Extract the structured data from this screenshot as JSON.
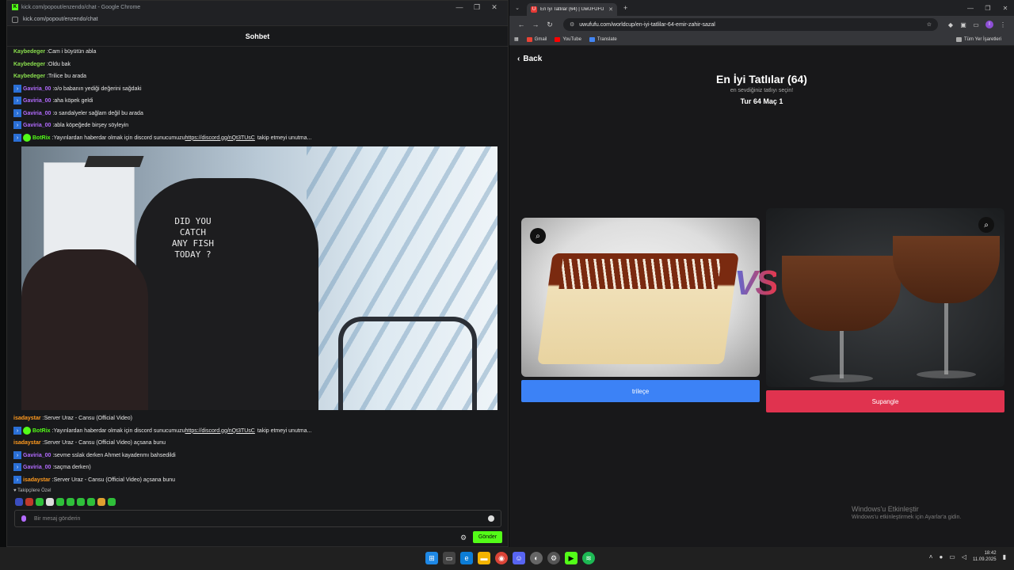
{
  "left_window": {
    "url_title": "kick.com/popout/enzendo/chat - Google Chrome",
    "url": "kick.com/popout/enzendo/chat",
    "window_controls": [
      "—",
      "❐",
      "✕"
    ],
    "chat_header": "Sohbet",
    "messages": [
      {
        "user": "Kaybedeger",
        "text": "Cam i büyütün abla",
        "color": "#8be04e",
        "badge": false
      },
      {
        "user": "Kaybedeger",
        "text": "Oldu bak",
        "color": "#8be04e",
        "badge": false
      },
      {
        "user": "Kaybedeger",
        "text": "Trilice bu arada",
        "color": "#8be04e",
        "badge": false
      },
      {
        "user": "Gaviria_00",
        "text": "o/o babanın yediği değerini sağdaki",
        "color": "#b36bff",
        "badge": true
      },
      {
        "user": "Gaviria_00",
        "text": "aha köpek geldi",
        "color": "#b36bff",
        "badge": true
      },
      {
        "user": "Gaviria_00",
        "text": "o sandalyeler sağlam değil bu arada",
        "color": "#b36bff",
        "badge": true
      },
      {
        "user": "Gaviria_00",
        "text": "abla köpeğede birşey söyleyin",
        "color": "#b36bff",
        "badge": true
      },
      {
        "user": "BotRix",
        "text": "Yayınlardan haberdar olmak için discord sunucumuzu",
        "link": "https://discord.gg/nQt3TUsC",
        "after": "takip etmeyi unutma...",
        "color": "#53fc18",
        "badge": true,
        "bot": true
      },
      {
        "user": "isadaystar",
        "text": "Server Uraz - Cansu (Official Video)",
        "color": "#ff9a1f",
        "badge": false
      },
      {
        "user": "BotRix",
        "text": "Yayınlardan haberdar olmak için discord sunucumuzu",
        "link": "https://discord.gg/nQt3TUsC",
        "after": "takip etmeyi unutma...",
        "color": "#53fc18",
        "badge": true,
        "bot": true
      },
      {
        "user": "isadaystar",
        "text": "Server Uraz - Cansu (Official Video) açsana bunu",
        "color": "#ff9a1f",
        "badge": false
      },
      {
        "user": "Gaviria_00",
        "text": "sevme sslak derken Ahmet kayadenmı bahsedildi",
        "color": "#b36bff",
        "badge": true
      },
      {
        "user": "Gaviria_00",
        "text": "saçma derken)",
        "color": "#b36bff",
        "badge": true
      },
      {
        "user": "isadaystar",
        "text": "Server Uraz - Cansu (Official Video) açsana bunu",
        "color": "#ff9a1f",
        "badge": true
      }
    ],
    "video_shirt_text": "DID YOU\nCATCH\nANY FISH\nTODAY ?",
    "followers_label": "Takipçilere Özel",
    "chat_placeholder": "Bir mesaj gönderin",
    "send_label": "Gönder"
  },
  "right_window": {
    "tab_title": "En İyi Tatlılar (64) | UwUFUFU",
    "url": "uwufufu.com/worldcup/en-iyi-tatlilar-64-emir-zahir-sazal",
    "bookmarks": [
      {
        "label": "Gmail",
        "color": "#ea4335"
      },
      {
        "label": "YouTube",
        "color": "#ff0000"
      },
      {
        "label": "Translate",
        "color": "#4285f4"
      }
    ],
    "all_bookmarks": "Tüm Yer İşaretleri",
    "profile_initial": "I",
    "back_label": "Back",
    "title": "En İyi Tatlılar (64)",
    "subtitle": "en sevdiğiniz tatlıyı seçin!",
    "round": "Tur 64 Maç 1",
    "vs": "VS",
    "option_left": "trileçe",
    "option_right": "Supangle",
    "watermark_title": "Windows'u Etkinleştir",
    "watermark_sub": "Windows'u etkinleştirmek için Ayarlar'a gidin."
  },
  "taskbar": {
    "time": "18:42",
    "date": "11.09.2025"
  }
}
